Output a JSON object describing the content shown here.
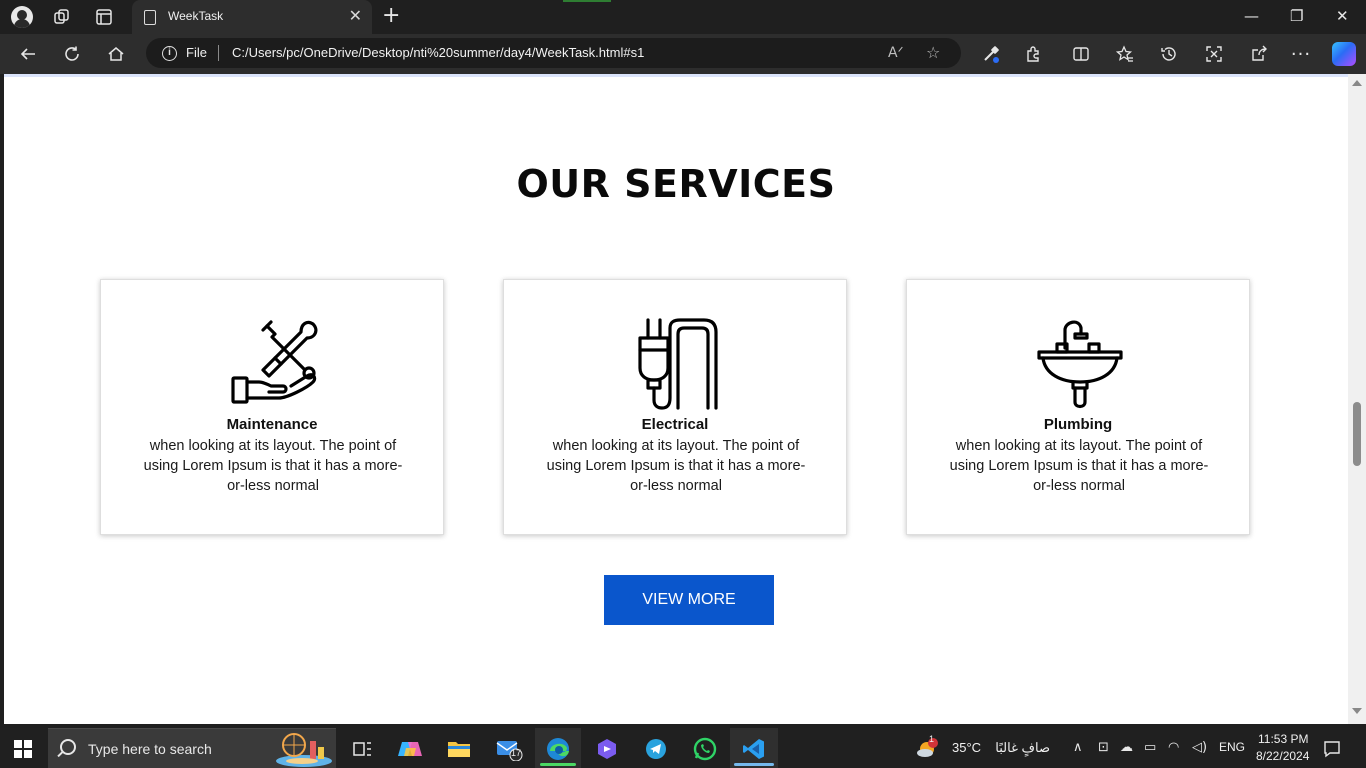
{
  "browser": {
    "tab_title": "WeekTask",
    "tab_close": "✕",
    "new_tab": "+",
    "address_prefix": "File",
    "url": "C:/Users/pc/OneDrive/Desktop/nti%20summer/day4/WeekTask.html#s1",
    "window_minimize": "—",
    "window_restore": "❐",
    "window_close": "✕"
  },
  "page": {
    "section_title": "OUR SERVICES",
    "cards": [
      {
        "title": "Maintenance",
        "text": "when looking at its layout. The point of using Lorem Ipsum is that it has a more-or-less normal",
        "icon": "tools-hand-icon"
      },
      {
        "title": "Electrical",
        "text": "when looking at its layout. The point of using Lorem Ipsum is that it has a more-or-less normal",
        "icon": "plug-icon"
      },
      {
        "title": "Plumbing",
        "text": "when looking at its layout. The point of using Lorem Ipsum is that it has a more-or-less normal",
        "icon": "sink-icon"
      }
    ],
    "view_more_label": "VIEW MORE",
    "button_color": "#0a56cc"
  },
  "taskbar": {
    "search_placeholder": "Type here to search",
    "mail_badge": "17",
    "weather_badge": "1",
    "temperature": "35°C",
    "weather_desc": "صافٍ غالبًا",
    "language": "ENG",
    "time": "11:53 PM",
    "date": "8/22/2024"
  }
}
